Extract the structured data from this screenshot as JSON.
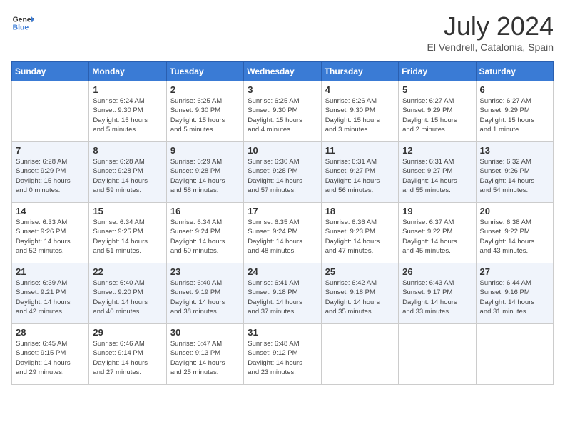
{
  "header": {
    "logo_general": "General",
    "logo_blue": "Blue",
    "month_year": "July 2024",
    "location": "El Vendrell, Catalonia, Spain"
  },
  "days_of_week": [
    "Sunday",
    "Monday",
    "Tuesday",
    "Wednesday",
    "Thursday",
    "Friday",
    "Saturday"
  ],
  "weeks": [
    [
      {
        "day": "",
        "content": ""
      },
      {
        "day": "1",
        "content": "Sunrise: 6:24 AM\nSunset: 9:30 PM\nDaylight: 15 hours\nand 5 minutes."
      },
      {
        "day": "2",
        "content": "Sunrise: 6:25 AM\nSunset: 9:30 PM\nDaylight: 15 hours\nand 5 minutes."
      },
      {
        "day": "3",
        "content": "Sunrise: 6:25 AM\nSunset: 9:30 PM\nDaylight: 15 hours\nand 4 minutes."
      },
      {
        "day": "4",
        "content": "Sunrise: 6:26 AM\nSunset: 9:30 PM\nDaylight: 15 hours\nand 3 minutes."
      },
      {
        "day": "5",
        "content": "Sunrise: 6:27 AM\nSunset: 9:29 PM\nDaylight: 15 hours\nand 2 minutes."
      },
      {
        "day": "6",
        "content": "Sunrise: 6:27 AM\nSunset: 9:29 PM\nDaylight: 15 hours\nand 1 minute."
      }
    ],
    [
      {
        "day": "7",
        "content": "Sunrise: 6:28 AM\nSunset: 9:29 PM\nDaylight: 15 hours\nand 0 minutes."
      },
      {
        "day": "8",
        "content": "Sunrise: 6:28 AM\nSunset: 9:28 PM\nDaylight: 14 hours\nand 59 minutes."
      },
      {
        "day": "9",
        "content": "Sunrise: 6:29 AM\nSunset: 9:28 PM\nDaylight: 14 hours\nand 58 minutes."
      },
      {
        "day": "10",
        "content": "Sunrise: 6:30 AM\nSunset: 9:28 PM\nDaylight: 14 hours\nand 57 minutes."
      },
      {
        "day": "11",
        "content": "Sunrise: 6:31 AM\nSunset: 9:27 PM\nDaylight: 14 hours\nand 56 minutes."
      },
      {
        "day": "12",
        "content": "Sunrise: 6:31 AM\nSunset: 9:27 PM\nDaylight: 14 hours\nand 55 minutes."
      },
      {
        "day": "13",
        "content": "Sunrise: 6:32 AM\nSunset: 9:26 PM\nDaylight: 14 hours\nand 54 minutes."
      }
    ],
    [
      {
        "day": "14",
        "content": "Sunrise: 6:33 AM\nSunset: 9:26 PM\nDaylight: 14 hours\nand 52 minutes."
      },
      {
        "day": "15",
        "content": "Sunrise: 6:34 AM\nSunset: 9:25 PM\nDaylight: 14 hours\nand 51 minutes."
      },
      {
        "day": "16",
        "content": "Sunrise: 6:34 AM\nSunset: 9:24 PM\nDaylight: 14 hours\nand 50 minutes."
      },
      {
        "day": "17",
        "content": "Sunrise: 6:35 AM\nSunset: 9:24 PM\nDaylight: 14 hours\nand 48 minutes."
      },
      {
        "day": "18",
        "content": "Sunrise: 6:36 AM\nSunset: 9:23 PM\nDaylight: 14 hours\nand 47 minutes."
      },
      {
        "day": "19",
        "content": "Sunrise: 6:37 AM\nSunset: 9:22 PM\nDaylight: 14 hours\nand 45 minutes."
      },
      {
        "day": "20",
        "content": "Sunrise: 6:38 AM\nSunset: 9:22 PM\nDaylight: 14 hours\nand 43 minutes."
      }
    ],
    [
      {
        "day": "21",
        "content": "Sunrise: 6:39 AM\nSunset: 9:21 PM\nDaylight: 14 hours\nand 42 minutes."
      },
      {
        "day": "22",
        "content": "Sunrise: 6:40 AM\nSunset: 9:20 PM\nDaylight: 14 hours\nand 40 minutes."
      },
      {
        "day": "23",
        "content": "Sunrise: 6:40 AM\nSunset: 9:19 PM\nDaylight: 14 hours\nand 38 minutes."
      },
      {
        "day": "24",
        "content": "Sunrise: 6:41 AM\nSunset: 9:18 PM\nDaylight: 14 hours\nand 37 minutes."
      },
      {
        "day": "25",
        "content": "Sunrise: 6:42 AM\nSunset: 9:18 PM\nDaylight: 14 hours\nand 35 minutes."
      },
      {
        "day": "26",
        "content": "Sunrise: 6:43 AM\nSunset: 9:17 PM\nDaylight: 14 hours\nand 33 minutes."
      },
      {
        "day": "27",
        "content": "Sunrise: 6:44 AM\nSunset: 9:16 PM\nDaylight: 14 hours\nand 31 minutes."
      }
    ],
    [
      {
        "day": "28",
        "content": "Sunrise: 6:45 AM\nSunset: 9:15 PM\nDaylight: 14 hours\nand 29 minutes."
      },
      {
        "day": "29",
        "content": "Sunrise: 6:46 AM\nSunset: 9:14 PM\nDaylight: 14 hours\nand 27 minutes."
      },
      {
        "day": "30",
        "content": "Sunrise: 6:47 AM\nSunset: 9:13 PM\nDaylight: 14 hours\nand 25 minutes."
      },
      {
        "day": "31",
        "content": "Sunrise: 6:48 AM\nSunset: 9:12 PM\nDaylight: 14 hours\nand 23 minutes."
      },
      {
        "day": "",
        "content": ""
      },
      {
        "day": "",
        "content": ""
      },
      {
        "day": "",
        "content": ""
      }
    ]
  ]
}
